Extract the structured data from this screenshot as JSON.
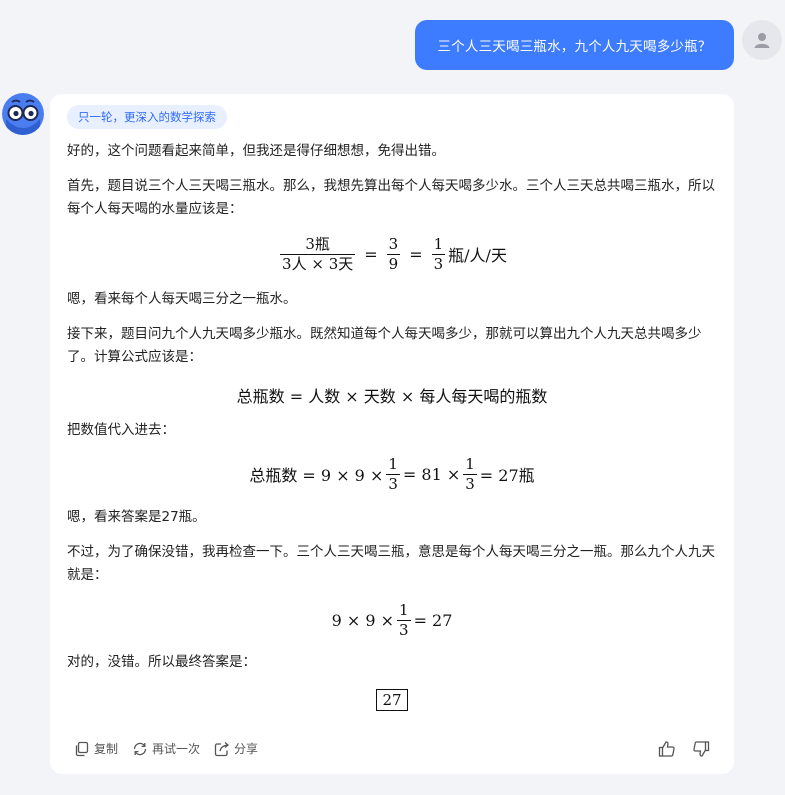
{
  "user_message": "三个人三天喝三瓶水，九个人九天喝多少瓶？",
  "answer": {
    "mode_tag": "只一轮，更深入的数学探索",
    "p1": "好的，这个问题看起来简单，但我还是得仔细想想，免得出错。",
    "p2": "首先，题目说三个人三天喝三瓶水。那么，我想先算出每个人每天喝多少水。三个人三天总共喝三瓶水，所以每个人每天喝的水量应该是：",
    "eq1": {
      "num1": "3瓶",
      "den1": "3人 × 3天",
      "eq_a": "=",
      "num2": "3",
      "den2": "9",
      "eq_b": "=",
      "num3": "1",
      "den3": "3",
      "unit": "瓶/人/天"
    },
    "p3": "嗯，看来每个人每天喝三分之一瓶水。",
    "p4": "接下来，题目问九个人九天喝多少瓶水。既然知道每个人每天喝多少，那就可以算出九个人九天总共喝多少了。计算公式应该是：",
    "eq2": "总瓶数 = 人数 × 天数 × 每人每天喝的瓶数",
    "p5": "把数值代入进去：",
    "eq3": {
      "lead": "总瓶数 = 9 × 9 ×",
      "num1": "1",
      "den1": "3",
      "mid": "= 81 ×",
      "num2": "1",
      "den2": "3",
      "tail": "= 27瓶"
    },
    "p6": "嗯，看来答案是27瓶。",
    "p7": "不过，为了确保没错，我再检查一下。三个人三天喝三瓶，意思是每个人每天喝三分之一瓶。那么九个人九天就是：",
    "eq4": {
      "lead": "9 × 9 ×",
      "num": "1",
      "den": "3",
      "tail": "= 27"
    },
    "p8": "对的，没错。所以最终答案是：",
    "final_answer": "27"
  },
  "actions": {
    "copy": "复制",
    "retry": "再试一次",
    "share": "分享"
  },
  "icons": {
    "user_avatar": "person-icon",
    "bot_avatar": "bot-glasses-icon",
    "copy": "copy-icon",
    "retry": "refresh-icon",
    "share": "share-icon",
    "like": "thumbs-up-icon",
    "dislike": "thumbs-down-icon"
  },
  "colors": {
    "accent": "#3d7bff",
    "background": "#f3f4f8",
    "tag_bg": "#e8f0ff",
    "tag_text": "#2f6bff"
  }
}
